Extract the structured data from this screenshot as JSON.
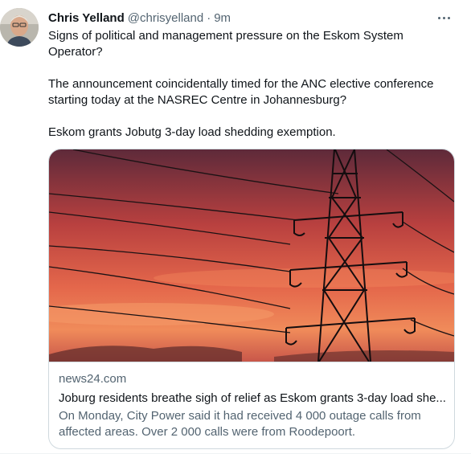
{
  "tweet": {
    "author_name": "Chris Yelland",
    "handle": "@chrisyelland",
    "separator": "·",
    "time": "9m",
    "paragraphs": [
      "Signs of political and management pressure on the Eskom System Operator?",
      "The announcement coincidentally timed for the ANC elective conference starting today at the NASREC Centre in Johannesburg?",
      "Eskom grants Jobutg 3-day load shedding exemption."
    ],
    "icons": {
      "more": "more-horizontal-icon"
    }
  },
  "card": {
    "domain": "news24.com",
    "title": "Joburg residents breathe sigh of relief as Eskom grants 3-day load she...",
    "description": "On Monday, City Power said it had received 4 000 outage calls from affected areas. Over 2 000 calls were from Roodepoort."
  },
  "colors": {
    "text_primary": "#0f1419",
    "text_secondary": "#536471",
    "border": "#cfd9de"
  }
}
